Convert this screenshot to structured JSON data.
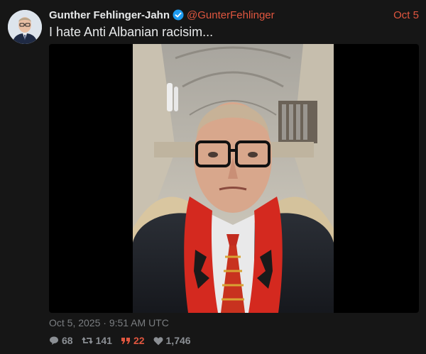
{
  "tweet": {
    "author_name": "Gunther Fehlinger-Jahn",
    "handle": "@GunterFehlinger",
    "date_short": "Oct 5",
    "text": "I hate Anti Albanian racisim...",
    "timestamp": "Oct 5, 2025 · 9:51 AM UTC",
    "stats": {
      "replies": "68",
      "retweets": "141",
      "quotes": "22",
      "likes": "1,746"
    }
  },
  "colors": {
    "accent": "#e0563f",
    "verified": "#1d9bf0",
    "background": "#161616"
  },
  "icons": [
    "verified-badge-icon",
    "reply-icon",
    "retweet-icon",
    "quote-icon",
    "like-icon"
  ]
}
